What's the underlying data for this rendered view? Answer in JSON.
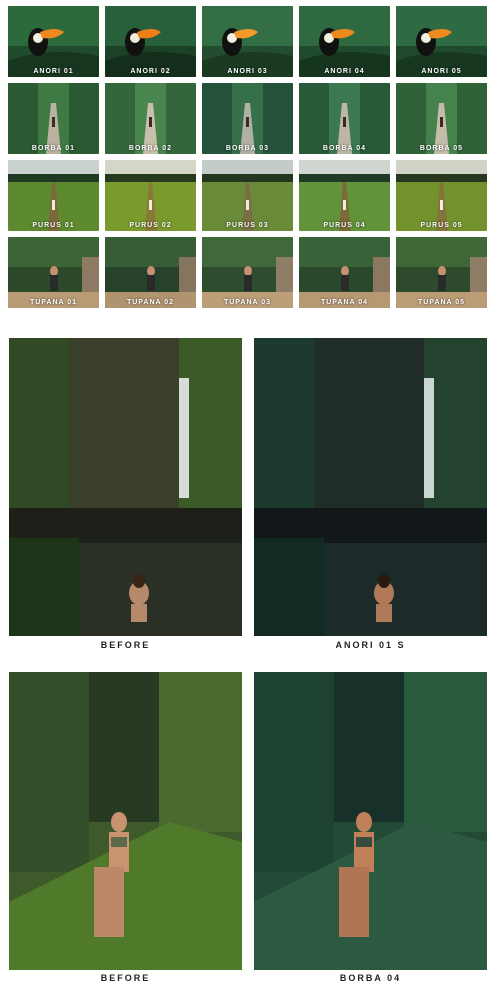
{
  "presets": [
    {
      "group": "anori",
      "labels": [
        "ANORI 01",
        "ANORI 02",
        "ANORI 03",
        "ANORI 04",
        "ANORI 05"
      ]
    },
    {
      "group": "borba",
      "labels": [
        "BORBA 01",
        "BORBA 02",
        "BORBA 03",
        "BORBA 04",
        "BORBA 05"
      ]
    },
    {
      "group": "purus",
      "labels": [
        "PURUS 01",
        "PURUS 02",
        "PURUS 03",
        "PURUS 04",
        "PURUS 05"
      ]
    },
    {
      "group": "tupana",
      "labels": [
        "TUPANA 01",
        "TUPANA 02",
        "TUPANA 03",
        "TUPANA 04",
        "TUPANA 05"
      ]
    }
  ],
  "comparisons": [
    {
      "before_label": "BEFORE",
      "after_label": "ANORI 01 S"
    },
    {
      "before_label": "BEFORE",
      "after_label": "BORBA 04"
    }
  ]
}
